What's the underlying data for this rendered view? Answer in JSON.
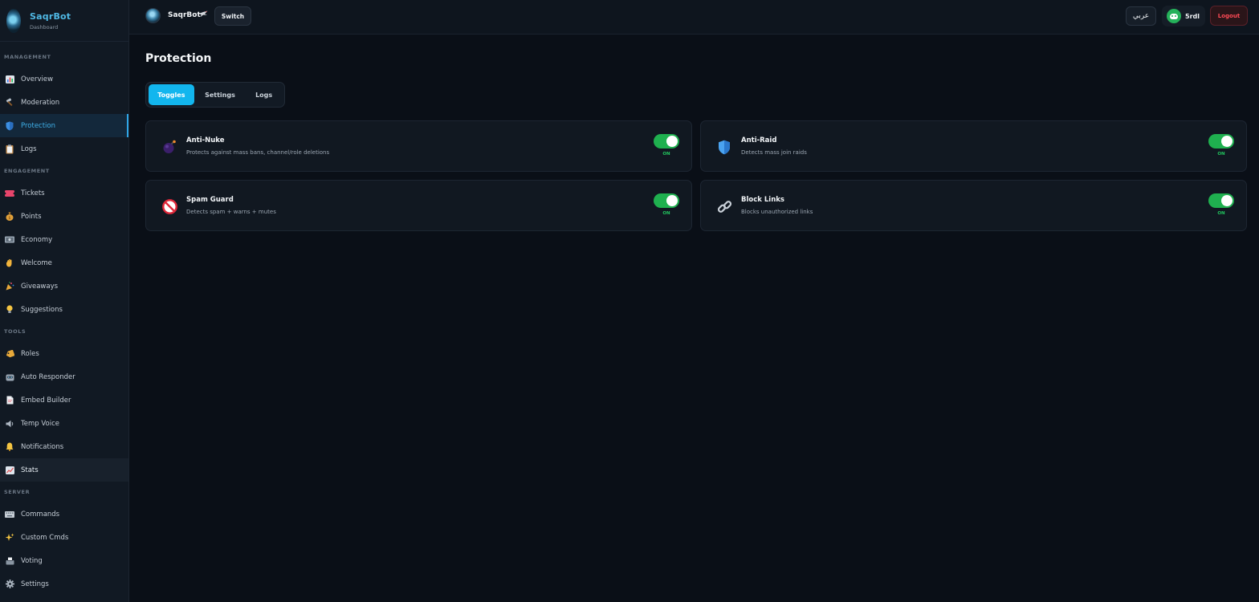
{
  "brand": {
    "title": "SaqrBot",
    "subtitle": "Dashboard"
  },
  "sidebar": {
    "sections": [
      {
        "label": "MANAGEMENT",
        "items": [
          {
            "label": "Overview",
            "icon": "chart-icon"
          },
          {
            "label": "Moderation",
            "icon": "hammer-icon"
          },
          {
            "label": "Protection",
            "icon": "shield-icon",
            "active": true
          },
          {
            "label": "Logs",
            "icon": "clipboard-icon"
          }
        ]
      },
      {
        "label": "ENGAGEMENT",
        "items": [
          {
            "label": "Tickets",
            "icon": "ticket-icon"
          },
          {
            "label": "Points",
            "icon": "money-bag-icon"
          },
          {
            "label": "Economy",
            "icon": "banknote-icon"
          },
          {
            "label": "Welcome",
            "icon": "wave-icon"
          },
          {
            "label": "Giveaways",
            "icon": "party-icon"
          },
          {
            "label": "Suggestions",
            "icon": "bulb-icon"
          }
        ]
      },
      {
        "label": "TOOLS",
        "items": [
          {
            "label": "Roles",
            "icon": "tag-icon"
          },
          {
            "label": "Auto Responder",
            "icon": "robot-icon"
          },
          {
            "label": "Embed Builder",
            "icon": "document-icon"
          },
          {
            "label": "Temp Voice",
            "icon": "speaker-icon"
          },
          {
            "label": "Notifications",
            "icon": "bell-icon"
          },
          {
            "label": "Stats",
            "icon": "trend-icon",
            "hover": true
          }
        ]
      },
      {
        "label": "SERVER",
        "items": [
          {
            "label": "Commands",
            "icon": "keyboard-icon"
          },
          {
            "label": "Custom Cmds",
            "icon": "sparkles-icon"
          },
          {
            "label": "Voting",
            "icon": "ballot-icon"
          },
          {
            "label": "Settings",
            "icon": "gear-icon"
          }
        ]
      }
    ]
  },
  "topbar": {
    "bot_name": "SaqrBot",
    "switch_label": "Switch",
    "language_label": "عربي",
    "user_name": "5rdl",
    "logout_label": "Logout"
  },
  "page": {
    "title": "Protection"
  },
  "tabs": [
    "Toggles",
    "Settings",
    "Logs"
  ],
  "cards": [
    {
      "title": "Anti-Nuke",
      "description": "Protects against mass bans, channel/role deletions",
      "state": "ON",
      "icon": "bomb-icon"
    },
    {
      "title": "Anti-Raid",
      "description": "Detects mass join raids",
      "state": "ON",
      "icon": "shield-icon"
    },
    {
      "title": "Spam Guard",
      "description": "Detects spam + warns + mutes",
      "state": "ON",
      "icon": "prohibited-icon"
    },
    {
      "title": "Block Links",
      "description": "Blocks unauthorized links",
      "state": "ON",
      "icon": "link-icon"
    }
  ],
  "colors": {
    "accent": "#12b6ee",
    "toggle_on": "#1fb04f",
    "logout": "#ff4a55",
    "background": "#0a0f17"
  }
}
